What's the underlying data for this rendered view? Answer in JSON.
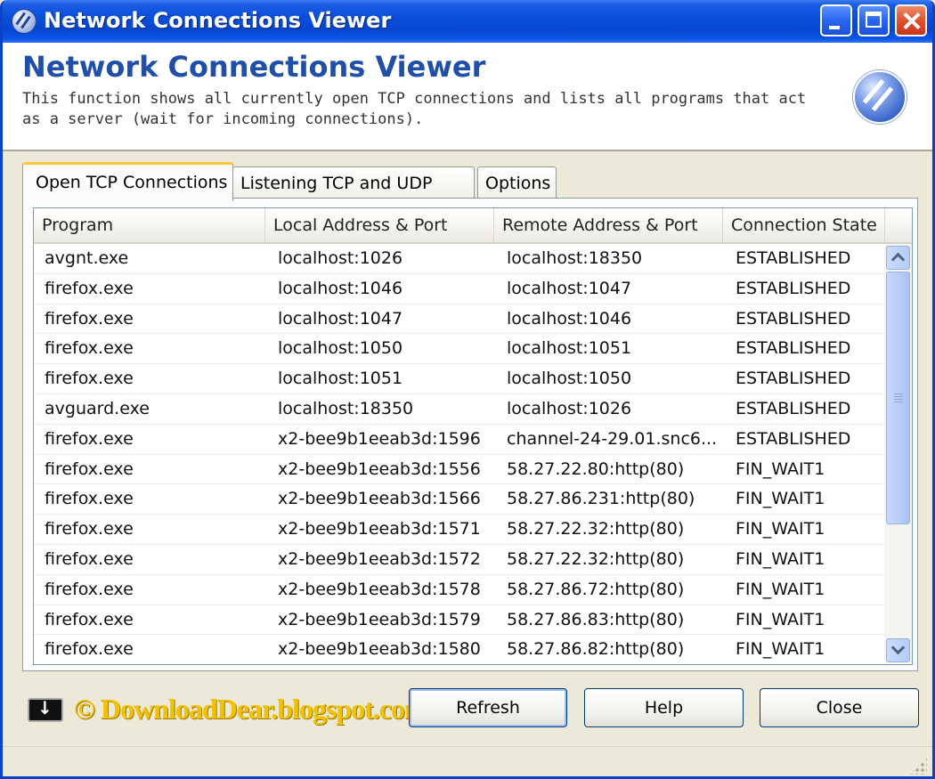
{
  "window": {
    "title": "Network Connections Viewer"
  },
  "header": {
    "title": "Network Connections Viewer",
    "description": "This function shows all currently open TCP connections and lists all programs that act as a server (wait for incoming connections)."
  },
  "tabs": [
    {
      "label": "Open TCP Connections",
      "active": true
    },
    {
      "label": "Listening TCP and UDP Ports",
      "active": false
    },
    {
      "label": "Options",
      "active": false
    }
  ],
  "table": {
    "columns": [
      "Program",
      "Local Address & Port",
      "Remote Address & Port",
      "Connection State"
    ],
    "rows": [
      [
        "avgnt.exe",
        "localhost:1026",
        "localhost:18350",
        "ESTABLISHED"
      ],
      [
        "firefox.exe",
        "localhost:1046",
        "localhost:1047",
        "ESTABLISHED"
      ],
      [
        "firefox.exe",
        "localhost:1047",
        "localhost:1046",
        "ESTABLISHED"
      ],
      [
        "firefox.exe",
        "localhost:1050",
        "localhost:1051",
        "ESTABLISHED"
      ],
      [
        "firefox.exe",
        "localhost:1051",
        "localhost:1050",
        "ESTABLISHED"
      ],
      [
        "avguard.exe",
        "localhost:18350",
        "localhost:1026",
        "ESTABLISHED"
      ],
      [
        "firefox.exe",
        "x2-bee9b1eeab3d:1596",
        "channel-24-29.01.snc6...",
        "ESTABLISHED"
      ],
      [
        "firefox.exe",
        "x2-bee9b1eeab3d:1556",
        "58.27.22.80:http(80)",
        "FIN_WAIT1"
      ],
      [
        "firefox.exe",
        "x2-bee9b1eeab3d:1566",
        "58.27.86.231:http(80)",
        "FIN_WAIT1"
      ],
      [
        "firefox.exe",
        "x2-bee9b1eeab3d:1571",
        "58.27.22.32:http(80)",
        "FIN_WAIT1"
      ],
      [
        "firefox.exe",
        "x2-bee9b1eeab3d:1572",
        "58.27.22.32:http(80)",
        "FIN_WAIT1"
      ],
      [
        "firefox.exe",
        "x2-bee9b1eeab3d:1578",
        "58.27.86.72:http(80)",
        "FIN_WAIT1"
      ],
      [
        "firefox.exe",
        "x2-bee9b1eeab3d:1579",
        "58.27.86.83:http(80)",
        "FIN_WAIT1"
      ],
      [
        "firefox.exe",
        "x2-bee9b1eeab3d:1580",
        "58.27.86.82:http(80)",
        "FIN_WAIT1"
      ]
    ]
  },
  "footer": {
    "watermark": "© DownloadDear.blogspot.com",
    "refresh_label": "Refresh",
    "help_label": "Help",
    "close_label": "Close"
  },
  "icons": {
    "app": "network-globe-icon",
    "download": "download-arrow-icon"
  },
  "colors": {
    "title_bar": "#0a4fd9",
    "header_title": "#1f4fa8",
    "active_tab_accent": "#ffc83c",
    "watermark": "#f2c200"
  }
}
